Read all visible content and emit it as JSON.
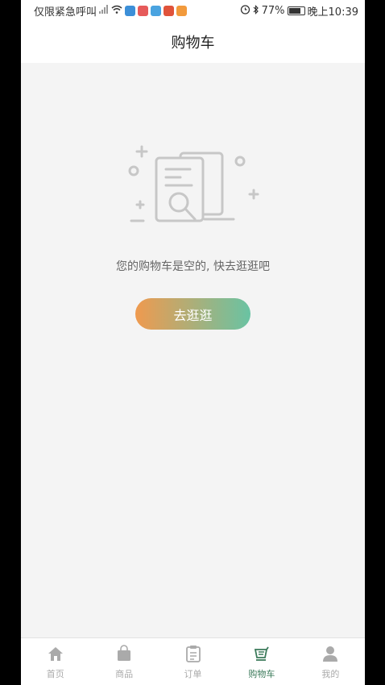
{
  "status_bar": {
    "carrier_text": "仅限紧急呼叫",
    "battery_text": "77%",
    "battery_level": 0.77,
    "time": "晚上10:39",
    "icons": [
      "signal-icon",
      "wifi-icon",
      "app-icon-blue",
      "app-icon-red",
      "app-icon-blue",
      "app-icon-news",
      "app-icon-orange",
      "alarm-icon",
      "bluetooth-icon",
      "battery-icon"
    ]
  },
  "header": {
    "title": "购物车"
  },
  "empty_state": {
    "illustration": "empty-document-search-icon",
    "message": "您的购物车是空的, 快去逛逛吧",
    "button_label": "去逛逛"
  },
  "tabbar": {
    "items": [
      {
        "label": "首页",
        "icon": "home-icon"
      },
      {
        "label": "商品",
        "icon": "shopping-bag-icon"
      },
      {
        "label": "订单",
        "icon": "clipboard-icon"
      },
      {
        "label": "购物车",
        "icon": "cart-icon"
      },
      {
        "label": "我的",
        "icon": "user-icon"
      }
    ],
    "active_index": 3
  },
  "colors": {
    "accent": "#3b7a5a",
    "button_gradient_start": "#ef9a4f",
    "button_gradient_end": "#69c3a3",
    "inactive": "#aaaaaa"
  }
}
